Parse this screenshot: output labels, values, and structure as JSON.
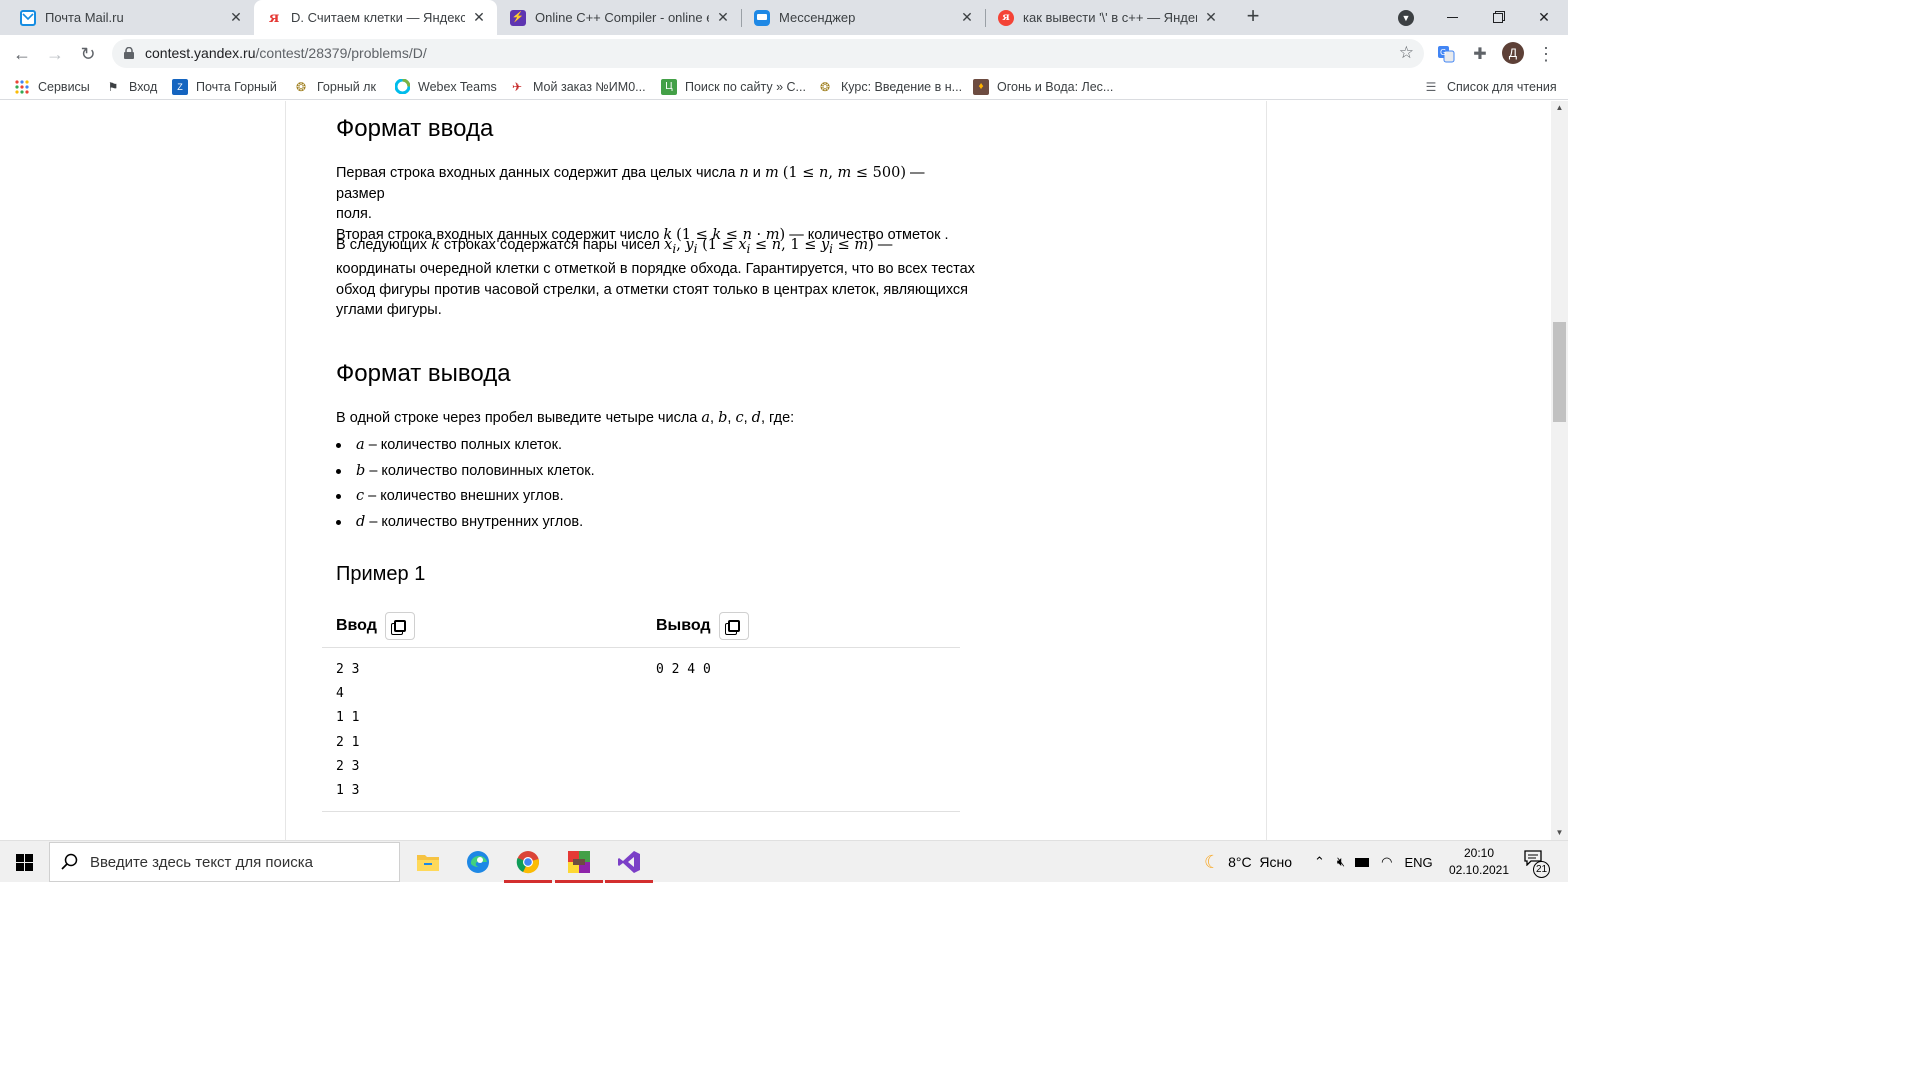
{
  "browser": {
    "tabs": [
      {
        "title": "Почта Mail.ru",
        "icon": "mail-icon",
        "active": false
      },
      {
        "title": "D. Считаем клетки — Яндекс, О",
        "icon": "yandex-icon",
        "active": true
      },
      {
        "title": "Online C++ Compiler - online ed",
        "icon": "compiler-icon",
        "active": false
      },
      {
        "title": "Мессенджер",
        "icon": "messenger-icon",
        "active": false
      },
      {
        "title": "как вывести '\\' в с++ — Яндекс",
        "icon": "yandex-search-icon",
        "active": false
      }
    ],
    "new_tab_label": "+",
    "url_host": "contest.yandex.ru",
    "url_path": "/contest/28379/problems/D/",
    "profile_letter": "Д"
  },
  "bookmarks": [
    {
      "label": "Сервисы",
      "icon": "apps-grid-icon"
    },
    {
      "label": "Вход",
      "icon": "flag-icon"
    },
    {
      "label": "Почта Горный",
      "icon": "mail-icon"
    },
    {
      "label": "Горный лк",
      "icon": "emblem-icon"
    },
    {
      "label": "Webex Teams",
      "icon": "webex-icon"
    },
    {
      "label": "Мой заказ №ИМ0...",
      "icon": "order-icon"
    },
    {
      "label": "Поиск по сайту » С...",
      "icon": "site-search-icon"
    },
    {
      "label": "Курс: Введение в н...",
      "icon": "emblem-icon"
    },
    {
      "label": "Огонь и Вода: Лес...",
      "icon": "game-icon"
    }
  ],
  "reading_list_label": "Список для чтения",
  "problem": {
    "input_format": {
      "title": "Формат ввода",
      "line1_a": "Первая строка входных данных содержит два целых числа",
      "line1_b": "— размер",
      "line1_c": "поля.",
      "line2_a": "Вторая строка входных данных содержит число",
      "line2_b": "— количество отметок .",
      "para2_a": "В следующих",
      "para2_b": "строках содержатся пары чисел",
      "para2_c": "координаты очередной клетки с отметкой в порядке обхода. Гарантируется, что во всех тестах",
      "para2_d": "обход фигуры против часовой стрелки, а отметки стоят только в центрах клеток, являющихся",
      "para2_e": "углами фигуры."
    },
    "output_format": {
      "title": "Формат вывода",
      "intro_a": "В одной строке через пробел выведите четыре числа",
      "intro_b": "где:",
      "items": [
        {
          "var": "a",
          "text": "– количество полных клеток."
        },
        {
          "var": "b",
          "text": "– количество половинных клеток."
        },
        {
          "var": "c",
          "text": "– количество внешних углов."
        },
        {
          "var": "d",
          "text": "– количество внутренних углов."
        }
      ]
    },
    "example": {
      "title": "Пример 1",
      "input_label": "Ввод",
      "output_label": "Вывод",
      "input_text": "2 3\n4\n1 1\n2 1\n2 3\n1 3",
      "output_text": "0 2 4 0"
    }
  },
  "taskbar": {
    "search_placeholder": "Введите здесь текст для поиска",
    "weather": "8°C  Ясно",
    "language": "ENG",
    "time": "20:10",
    "date": "02.10.2021",
    "notification_count": "21"
  }
}
